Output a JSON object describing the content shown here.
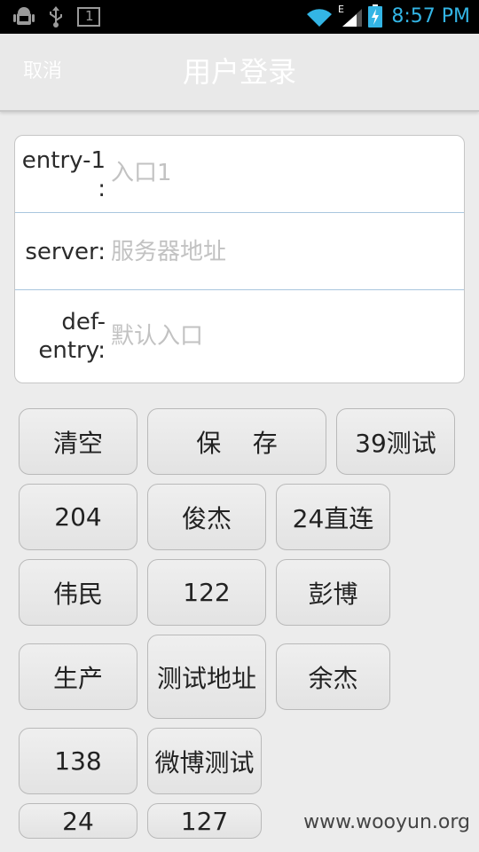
{
  "status_bar": {
    "time": "8:57 PM",
    "network_type": "E",
    "notification_count": "1",
    "icons": [
      "android-debug-icon",
      "usb-icon",
      "notification-icon",
      "wifi-icon",
      "signal-icon",
      "battery-charging-icon"
    ]
  },
  "header": {
    "cancel_label": "取消",
    "title": "用户登录"
  },
  "form": {
    "fields": [
      {
        "label": "entry-1\n:",
        "placeholder": "入口1",
        "value": ""
      },
      {
        "label": "server:",
        "placeholder": "服务器地址",
        "value": ""
      },
      {
        "label": "def-\nentry:",
        "placeholder": "默认入口",
        "value": ""
      }
    ]
  },
  "buttons": {
    "clear": "清空",
    "save": "保    存",
    "test39": "39测试",
    "b204": "204",
    "junjie": "俊杰",
    "direct24": "24直连",
    "weimin": "伟民",
    "b122": "122",
    "pengbo": "彭博",
    "production": "生产",
    "test_address": "测试地址",
    "yujie": "余杰",
    "b138": "138",
    "weibo_test": "微博测试",
    "b24": "24",
    "b127": "127"
  },
  "watermark": "www.wooyun.org",
  "colors": {
    "accent_time": "#33b5e5",
    "background": "#ececec",
    "divider": "#a9c6de"
  }
}
